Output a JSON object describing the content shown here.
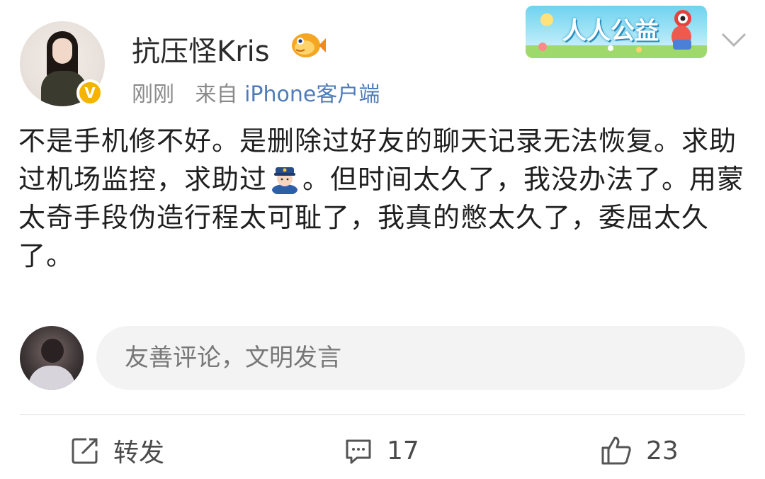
{
  "post": {
    "username": "抗压怪Kris",
    "time": "刚刚",
    "source_prefix": "来自",
    "source_client": "iPhone客户端",
    "text_part1": "不是手机修不好。是删除过好友的聊天记录无法恢复。求助过机场监控，求助过",
    "text_part2": "。但时间太久了，我没办法了。用蒙太奇手段伪造行程太可耻了，我真的憋太久了，委屈太久了。"
  },
  "badges": {
    "verified": "V",
    "charity_banner": "人人公益"
  },
  "icons": {
    "avatar": "user-avatar-photo",
    "verified": "verified-badge-icon",
    "fish": "fish-membership-icon",
    "chevron": "chevron-down-icon",
    "police": "police-officer-emoji",
    "repost": "share-square-icon",
    "comment": "comment-bubble-icon",
    "like": "thumbs-up-icon"
  },
  "comment_box": {
    "placeholder": "友善评论，文明发言"
  },
  "actions": {
    "repost_label": "转发",
    "comment_count": "17",
    "like_count": "23"
  },
  "colors": {
    "link": "#4f7cb8",
    "meta": "#8a8a8a",
    "verified": "#f5b400",
    "banner": "#6fd2ef"
  }
}
